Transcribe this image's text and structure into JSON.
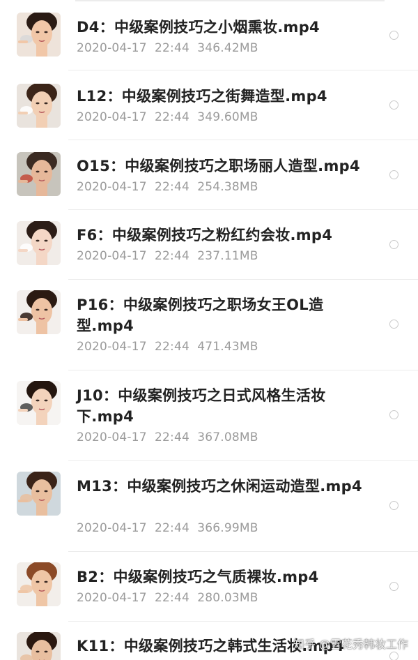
{
  "files": [
    {
      "name": "D4：中级案例技巧之小烟熏妆.mp4",
      "date": "2020-04-17",
      "time": "22:44",
      "size": "346.42MB",
      "thumbnail": "face-makeup-thumbnail"
    },
    {
      "name": "L12：中级案例技巧之街舞造型.mp4",
      "date": "2020-04-17",
      "time": "22:44",
      "size": "349.60MB",
      "thumbnail": "face-makeup-thumbnail"
    },
    {
      "name": "O15：中级案例技巧之职场丽人造型.mp4",
      "date": "2020-04-17",
      "time": "22:44",
      "size": "254.38MB",
      "thumbnail": "face-makeup-thumbnail"
    },
    {
      "name": "F6：中级案例技巧之粉红约会妆.mp4",
      "date": "2020-04-17",
      "time": "22:44",
      "size": "237.11MB",
      "thumbnail": "face-makeup-thumbnail"
    },
    {
      "name": "P16：中级案例技巧之职场女王OL造型.mp4",
      "date": "2020-04-17",
      "time": "22:44",
      "size": "471.43MB",
      "thumbnail": "face-makeup-thumbnail"
    },
    {
      "name": "J10：中级案例技巧之日式风格生活妆下.mp4",
      "date": "2020-04-17",
      "time": "22:44",
      "size": "367.08MB",
      "thumbnail": "face-makeup-thumbnail"
    },
    {
      "name": "M13：中级案例技巧之休闲运动造型.mp4",
      "date": "2020-04-17",
      "time": "22:44",
      "size": "366.99MB",
      "thumbnail": "face-makeup-thumbnail"
    },
    {
      "name": "B2：中级案例技巧之气质裸妆.mp4",
      "date": "2020-04-17",
      "time": "22:44",
      "size": "280.03MB",
      "thumbnail": "face-makeup-thumbnail"
    },
    {
      "name": "K11：中级案例技巧之韩式生活妆.mp4",
      "date": "",
      "time": "",
      "size": "",
      "thumbnail": "face-makeup-thumbnail"
    }
  ],
  "watermark": "知乎 @雪花秀韩妆工作",
  "colors": {
    "title": "#222222",
    "meta": "#9b9b9b",
    "divider": "#ececec",
    "radio_border": "#c9c9c9"
  }
}
